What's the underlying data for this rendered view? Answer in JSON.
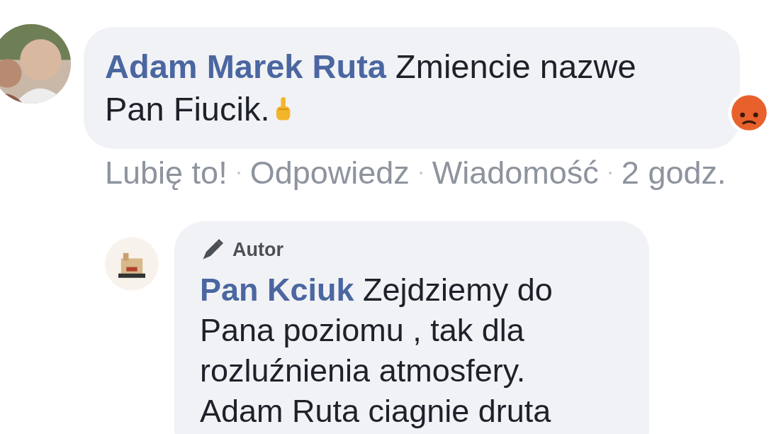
{
  "comment": {
    "author": "Adam Marek Ruta",
    "lines": [
      "Zmiencie nazwe",
      "Pan Fiucik."
    ],
    "emoji": {
      "kind": "finger"
    },
    "reaction": {
      "kind": "angry"
    },
    "actions": [
      "Lubię to!",
      "Odpowiedz",
      "Wiadomość"
    ],
    "time": "2 godz."
  },
  "reply": {
    "badge": "Autor",
    "author": "Pan Kciuk",
    "text": "Zejdziemy do Pana poziomu , tak dla rozluźnienia atmosfery. Adam Ruta ciagnie druta"
  }
}
